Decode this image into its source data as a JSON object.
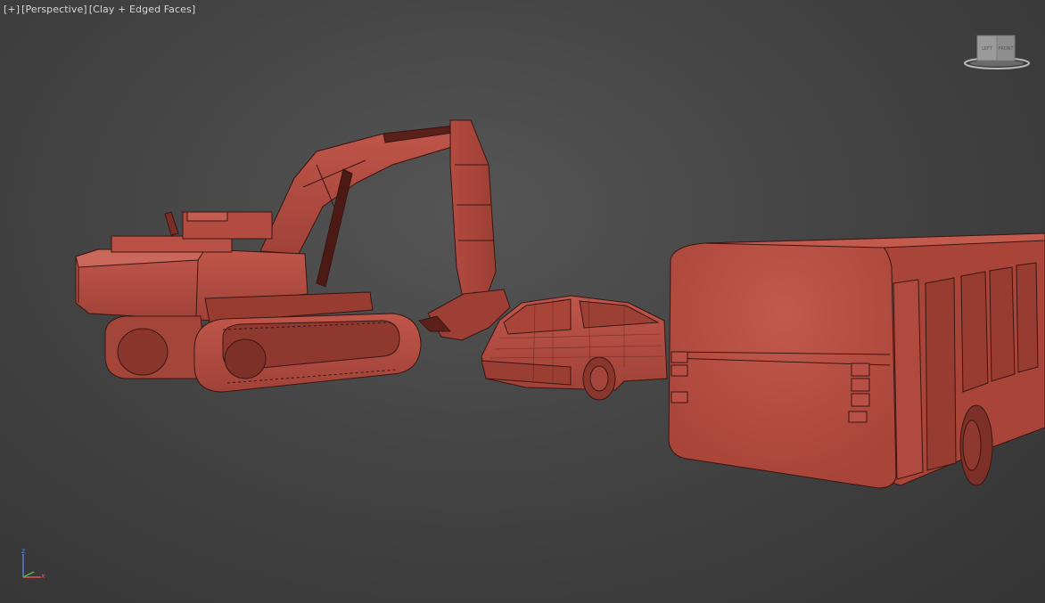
{
  "viewport": {
    "label_plus": "[+]",
    "label_view": "[Perspective]",
    "label_shading": "[Clay + Edged Faces]"
  },
  "viewcube": {
    "face_labels": [
      "LEFT",
      "FRONT"
    ]
  },
  "axis_tripod": {
    "z_label": "z",
    "x_label": "x",
    "colors": {
      "x": "#e05050",
      "y": "#4fbf4f",
      "z": "#5c7bd9"
    }
  },
  "scene": {
    "objects": [
      "excavator",
      "hatchback-car",
      "bus"
    ],
    "clay_color": "#b04a3e",
    "edge_color": "#3a1612"
  },
  "colors": {
    "background": "#454545",
    "label_text": "#d6d6d6"
  }
}
